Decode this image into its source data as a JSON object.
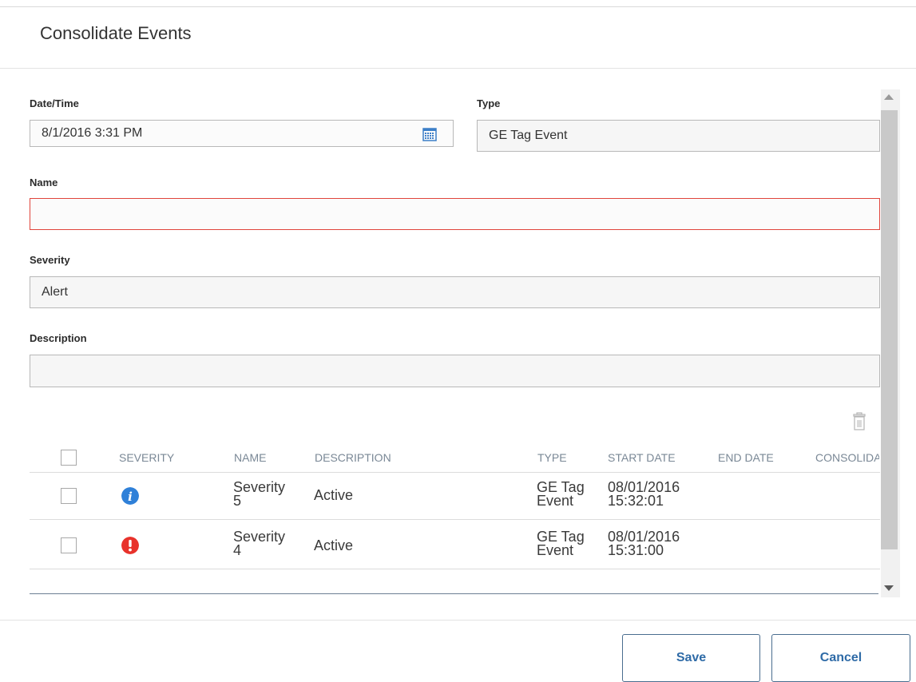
{
  "dialog": {
    "title": "Consolidate Events"
  },
  "form": {
    "datetime_label": "Date/Time",
    "datetime_value": "8/1/2016 3:31 PM",
    "type_label": "Type",
    "type_value": "GE Tag Event",
    "name_label": "Name",
    "name_value": "",
    "severity_label": "Severity",
    "severity_value": "Alert",
    "description_label": "Description",
    "description_value": ""
  },
  "table": {
    "columns": [
      "SEVERITY",
      "NAME",
      "DESCRIPTION",
      "TYPE",
      "START DATE",
      "END DATE",
      "CONSOLIDA"
    ],
    "rows": [
      {
        "severity_icon": "info-icon",
        "name_line1": "Severity",
        "name_line2": "5",
        "description": "Active",
        "type_line1": "GE Tag",
        "type_line2": "Event",
        "start_line1": "08/01/2016",
        "start_line2": "15:32:01",
        "end_date": ""
      },
      {
        "severity_icon": "alert-icon",
        "name_line1": "Severity",
        "name_line2": "4",
        "description": "Active",
        "type_line1": "GE Tag",
        "type_line2": "Event",
        "start_line1": "08/01/2016",
        "start_line2": "15:31:00",
        "end_date": ""
      }
    ]
  },
  "buttons": {
    "save": "Save",
    "cancel": "Cancel"
  },
  "colors": {
    "accent": "#2f6ba7",
    "error": "#e0443b",
    "info": "#2f80d8",
    "alert": "#e8322b"
  },
  "icons": {
    "calendar": "calendar-icon",
    "trash": "trash-icon"
  }
}
